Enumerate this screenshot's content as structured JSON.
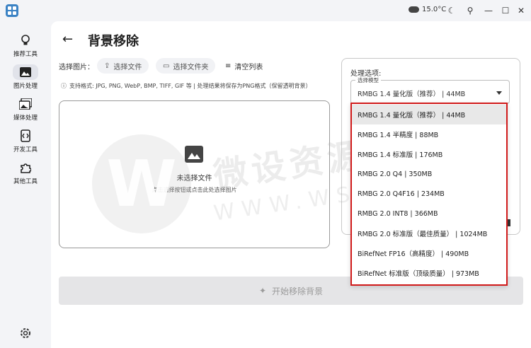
{
  "titlebar": {
    "weather": "15.0°C",
    "icons": [
      "app-icon",
      "cloud-icon",
      "moon-icon",
      "pin-icon",
      "minimize-icon",
      "maximize-icon",
      "close-icon"
    ]
  },
  "sidebar": {
    "items": [
      {
        "label": "推荐工具",
        "icon": "lightbulb-icon"
      },
      {
        "label": "图片处理",
        "icon": "image-icon",
        "active": true
      },
      {
        "label": "媒体处理",
        "icon": "media-icon"
      },
      {
        "label": "开发工具",
        "icon": "code-icon"
      },
      {
        "label": "其他工具",
        "icon": "puzzle-icon"
      }
    ],
    "settings_icon": "gear-icon"
  },
  "main": {
    "title": "背景移除",
    "select_image_label": "选择图片：",
    "select_file": "选择文件",
    "select_folder": "选择文件夹",
    "clear_list": "清空列表",
    "format_note": "支持格式: JPG, PNG, WebP, BMP, TIFF, GIF 等 | 处理结果将保存为PNG格式（保留透明背景）",
    "drop_title": "未选择文件",
    "drop_hint": "点击选择按钮或点击此处选择图片",
    "start_button": "开始移除背景"
  },
  "options": {
    "title": "处理选项:",
    "model_select_label": "选择模型",
    "model_select_value": "RMBG 1.4 量化版（推荐） | 44MB",
    "models": [
      "RMBG 1.4 量化版（推荐） | 44MB",
      "RMBG 1.4 半精度 | 88MB",
      "RMBG 1.4 标准版 | 176MB",
      "RMBG 2.0 Q4 | 350MB",
      "RMBG 2.0 Q4F16 | 234MB",
      "RMBG 2.0 INT8 | 366MB",
      "RMBG 2.0 标准版（最佳质量） | 1024MB",
      "BiRefNet FP16（高精度） | 490MB",
      "BiRefNet 标准版（顶级质量） | 973MB"
    ],
    "selected_index": 0
  },
  "watermark": {
    "text": "微设资源库",
    "url": "WWW.WSZYK.COM"
  },
  "colors": {
    "highlight_border": "#d11a1a",
    "disabled_button": "#e5e5e7"
  }
}
